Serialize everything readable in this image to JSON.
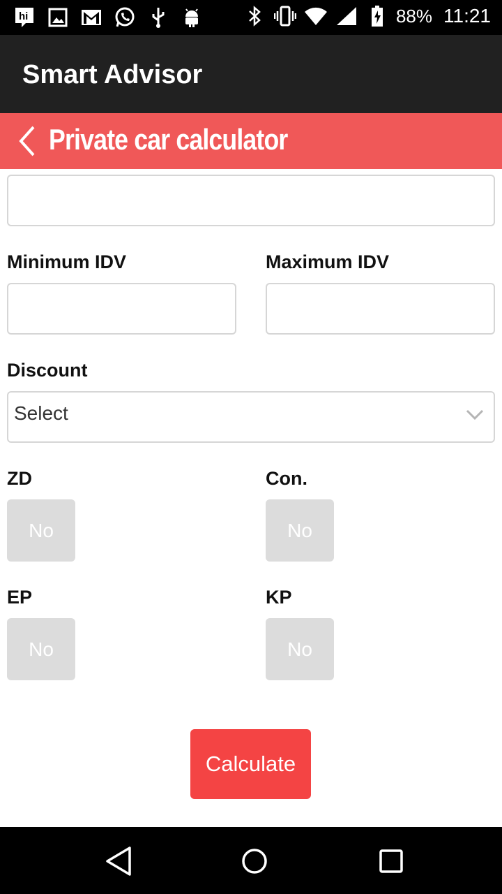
{
  "status_bar": {
    "battery": "88%",
    "time": "11:21",
    "left_icons": [
      "hike-icon",
      "image-icon",
      "gmail-icon",
      "whatsapp-icon",
      "usb-icon",
      "android-icon"
    ],
    "right_icons": [
      "bluetooth-icon",
      "vibrate-icon",
      "wifi-icon",
      "signal-icon",
      "battery-charging-icon"
    ]
  },
  "app_bar": {
    "title": "Smart Advisor"
  },
  "subheader": {
    "title": "Private car calculator",
    "back_icon": "chevron-left-icon"
  },
  "form": {
    "top_input_value": "",
    "min_idv": {
      "label": "Minimum IDV",
      "value": ""
    },
    "max_idv": {
      "label": "Maximum IDV",
      "value": ""
    },
    "discount": {
      "label": "Discount",
      "selected": "Select"
    },
    "zd": {
      "label": "ZD",
      "value": "No"
    },
    "con": {
      "label": "Con.",
      "value": "No"
    },
    "ep": {
      "label": "EP",
      "value": "No"
    },
    "kp": {
      "label": "KP",
      "value": "No"
    },
    "calculate_label": "Calculate"
  },
  "colors": {
    "app_bar": "#212121",
    "header": "#f05858",
    "button": "#f44444",
    "toggle": "#dcdcdc"
  },
  "nav_bar": {
    "icons": [
      "back-triangle-icon",
      "home-circle-icon",
      "recents-square-icon"
    ]
  }
}
